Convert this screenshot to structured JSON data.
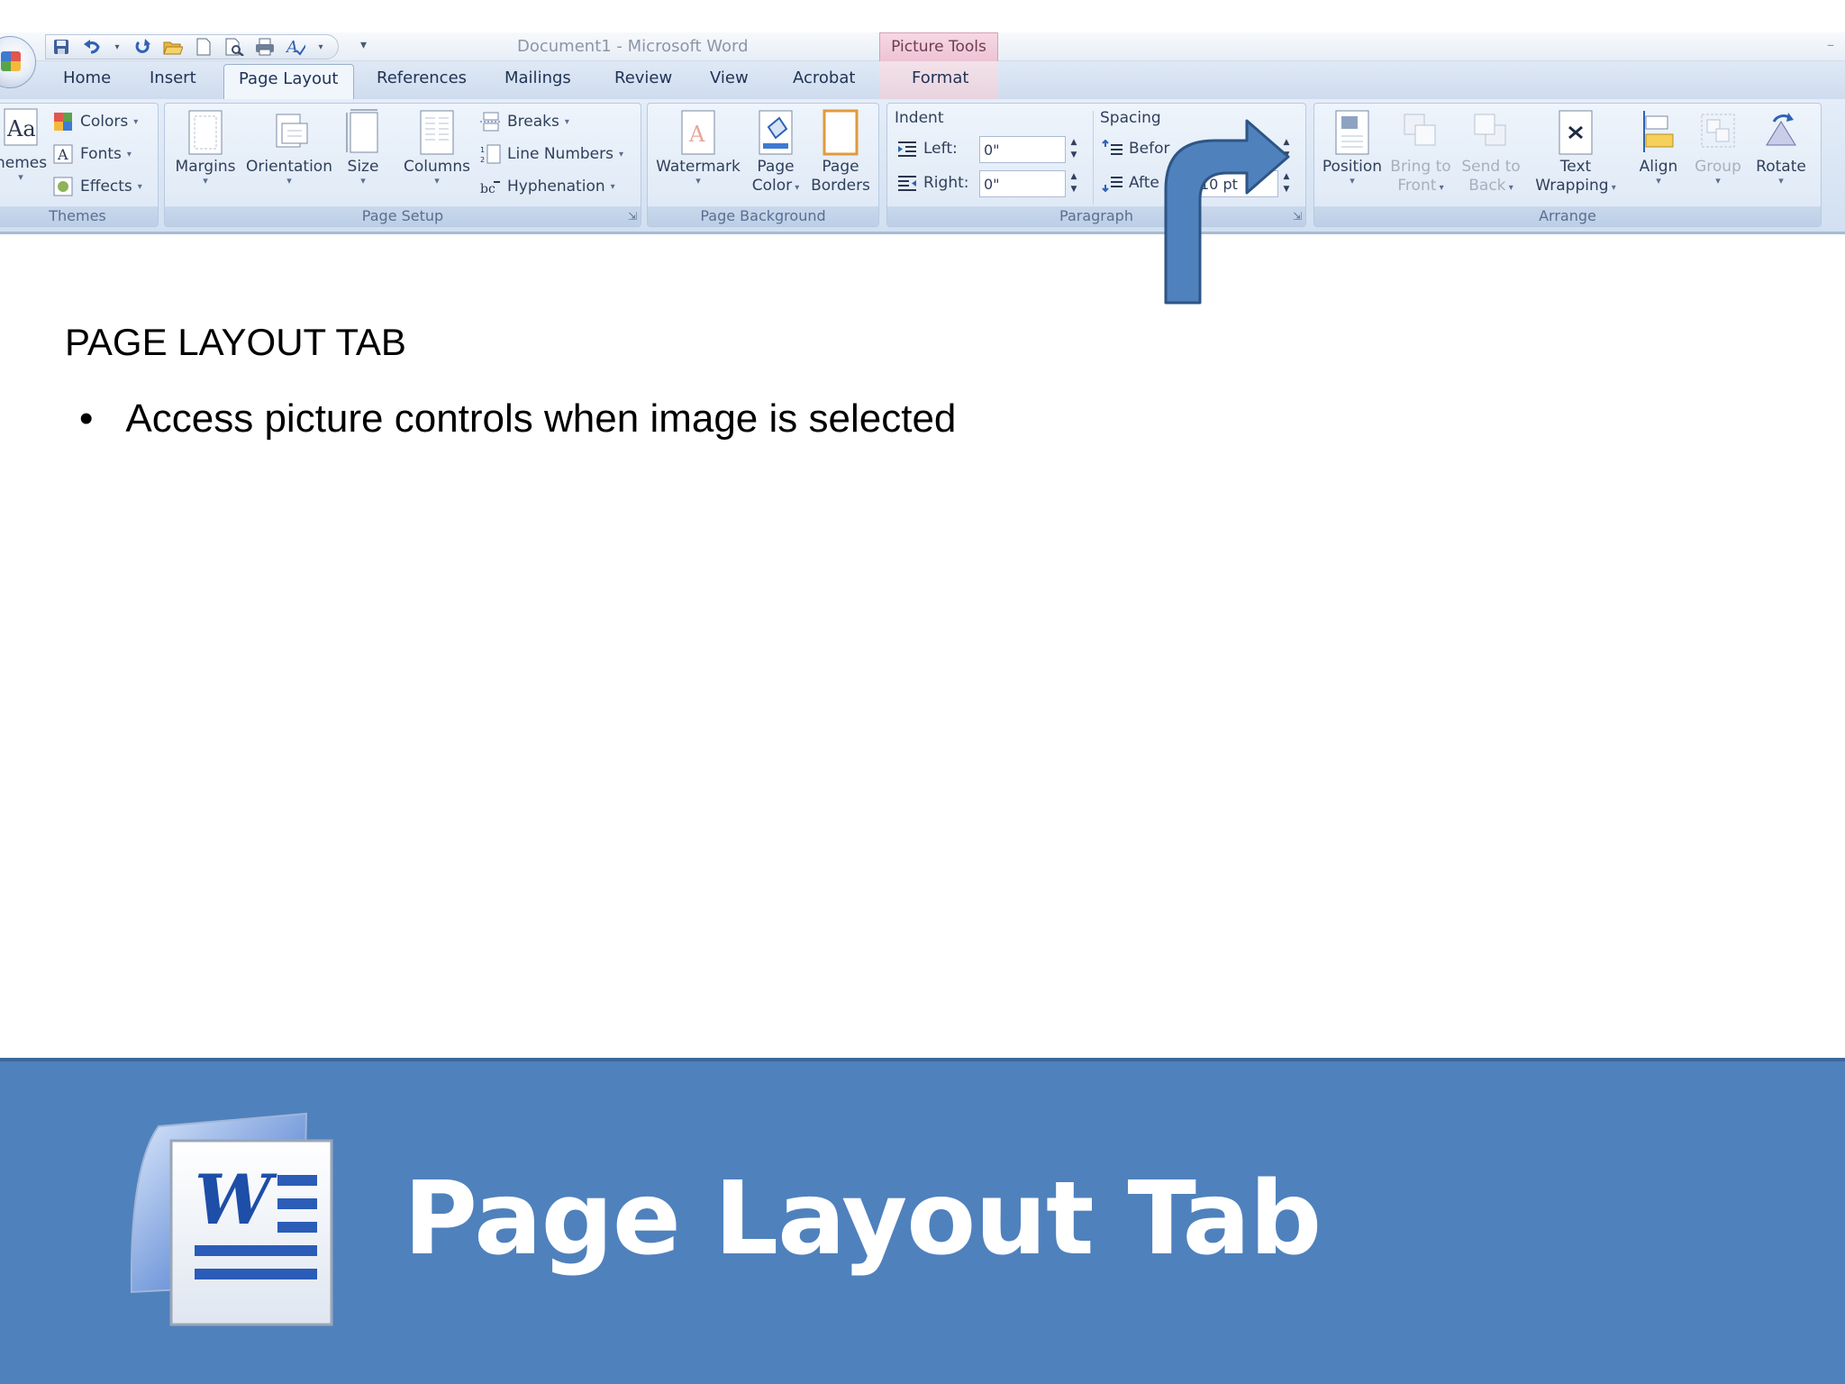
{
  "window": {
    "title": "Document1 - Microsoft Word",
    "contextual_tab_group": "Picture Tools"
  },
  "quick_access": {
    "icons": [
      "save-icon",
      "undo-icon",
      "redo-icon",
      "open-icon",
      "new-document-icon",
      "print-preview-icon",
      "print-icon",
      "spelling-icon"
    ],
    "customize_label": "▾"
  },
  "tabs": [
    {
      "label": "Home"
    },
    {
      "label": "Insert"
    },
    {
      "label": "Page Layout"
    },
    {
      "label": "References"
    },
    {
      "label": "Mailings"
    },
    {
      "label": "Review"
    },
    {
      "label": "View"
    },
    {
      "label": "Acrobat"
    },
    {
      "label": "Format"
    }
  ],
  "ribbon": {
    "themes": {
      "label": "Themes",
      "themes_button": "hemes",
      "colors": "Colors",
      "fonts": "Fonts",
      "effects": "Effects"
    },
    "page_setup": {
      "label": "Page Setup",
      "margins": "Margins",
      "orientation": "Orientation",
      "size": "Size",
      "columns": "Columns",
      "breaks": "Breaks",
      "line_numbers": "Line Numbers",
      "hyphenation": "Hyphenation"
    },
    "page_background": {
      "label": "Page Background",
      "watermark": "Watermark",
      "page_color": [
        "Page",
        "Color"
      ],
      "page_borders": [
        "Page",
        "Borders"
      ]
    },
    "paragraph": {
      "label": "Paragraph",
      "indent_heading": "Indent",
      "spacing_heading": "Spacing",
      "left_label": "Left:",
      "left_value": "0\"",
      "right_label": "Right:",
      "right_value": "0\"",
      "before_label": "Befor",
      "after_label": "Afte",
      "after_value": "10 pt"
    },
    "arrange": {
      "label": "Arrange",
      "position": "Position",
      "bring_to_front": [
        "Bring to",
        "Front"
      ],
      "send_to_back": [
        "Send to",
        "Back"
      ],
      "text_wrapping": [
        "Text",
        "Wrapping"
      ],
      "align": "Align",
      "group": "Group",
      "rotate": "Rotate"
    }
  },
  "slide": {
    "heading": "PAGE LAYOUT TAB",
    "bullets": [
      "Access picture controls when image is selected"
    ],
    "bullet_glyph": "•"
  },
  "banner": {
    "title": "Page Layout Tab",
    "logo_letter": "W"
  },
  "colors": {
    "banner": "#4f81bd",
    "arrow": "#4f81bd",
    "arrow_outline": "#2e5585"
  }
}
